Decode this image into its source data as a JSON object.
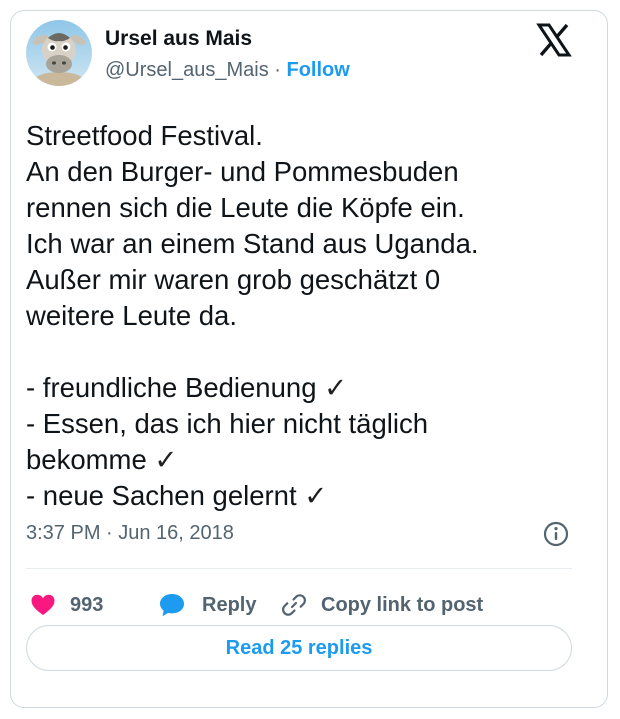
{
  "author": {
    "display_name": "Ursel aus Mais",
    "handle": "@Ursel_aus_Mais",
    "separator": " · ",
    "follow_label": "Follow",
    "avatar_icon": "cartoon-cow-avatar"
  },
  "brand_icon": "x-logo-icon",
  "tweet": {
    "lines": [
      "Streetfood Festival.",
      "An den Burger- und Pommesbuden",
      "rennen sich die Leute die Köpfe ein.",
      "Ich war an einem Stand aus Uganda.",
      "Außer mir waren grob geschätzt 0",
      "weitere Leute da.",
      "",
      "- freundliche Bedienung ",
      "- Essen, das ich hier nicht täglich",
      "bekomme ",
      "- neue Sachen gelernt "
    ],
    "checkmark": "✓"
  },
  "timestamp": "3:37 PM · Jun 16, 2018",
  "actions": {
    "like_count": "993",
    "reply_label": "Reply",
    "copy_link_label": "Copy link to post"
  },
  "read_replies_label": "Read 25 replies",
  "colors": {
    "accent": "#1d9bf0",
    "like": "#f91880",
    "text": "#0f1419",
    "muted": "#536471",
    "border": "#cfd9de"
  }
}
